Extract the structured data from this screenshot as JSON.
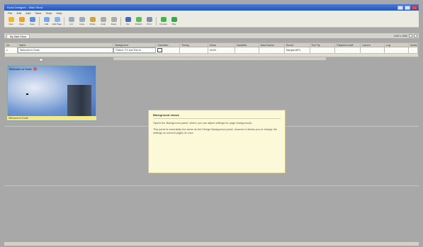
{
  "window": {
    "title": "Kiosk Designer - Slide Show",
    "controls": [
      "minimize",
      "maximize",
      "close"
    ]
  },
  "menu": [
    "File",
    "Edit",
    "Add",
    "View",
    "Tools",
    "Help"
  ],
  "toolbar": [
    {
      "label": "New",
      "icon": "new-icon",
      "color": "#e8b93a"
    },
    {
      "label": "Open",
      "icon": "open-icon",
      "color": "#e0a43a"
    },
    {
      "label": "Save",
      "icon": "save-icon",
      "color": "#5d8fd6"
    },
    {
      "label": "Add",
      "icon": "add-slide-icon",
      "color": "#7aa7e0"
    },
    {
      "label": "Edit Page",
      "icon": "edit-page-icon",
      "color": "#8fb3e6"
    },
    {
      "label": "Cut",
      "icon": "cut-icon",
      "color": "#9ab"
    },
    {
      "label": "Copy",
      "icon": "copy-icon",
      "color": "#9ab"
    },
    {
      "label": "Paste",
      "icon": "paste-icon",
      "color": "#c9a24a"
    },
    {
      "label": "Undo",
      "icon": "undo-icon",
      "color": "#aaa"
    },
    {
      "label": "Redo",
      "icon": "redo-icon",
      "color": "#aaa"
    },
    {
      "label": "Set",
      "icon": "settings-icon",
      "color": "#4a68b8"
    },
    {
      "label": "Publish",
      "icon": "publish-icon",
      "color": "#5cb85c"
    },
    {
      "label": "Print",
      "icon": "print-icon",
      "color": "#7f8fa6"
    },
    {
      "label": "Preview",
      "icon": "preview-icon",
      "color": "#4caf50"
    },
    {
      "label": "Play",
      "icon": "play-icon",
      "color": "#3fa34d"
    }
  ],
  "tabs": [
    {
      "label": "My Slide Show"
    }
  ],
  "zoom": {
    "label": "1920 x 1080"
  },
  "grid": {
    "columns": [
      "No.",
      "Name",
      "Background",
      "Transition",
      "Timing",
      "Music",
      "Variables",
      "Data Source",
      "Sound",
      "Tool Tip",
      "Playback Audit",
      "Launch",
      "Log",
      "Media"
    ],
    "rows": [
      {
        "cells": [
          "1",
          "Welcome to Dude",
          "Picture, FX and Trim to",
          "",
          "",
          "00:00",
          "",
          "",
          "",
          "",
          "Sample.MP3",
          "",
          "",
          ""
        ]
      }
    ]
  },
  "slide": {
    "title": "Welcome to Dude",
    "caption": "Welcome to Dude"
  },
  "tooltip": {
    "title": "Background shows",
    "paragraphs": [
      "Opens the Background panel, where you can adjust settings for page backgrounds.",
      "This panel is essentially the same as the Design Background panel, however it allows you to change the settings on several pages at once."
    ]
  }
}
